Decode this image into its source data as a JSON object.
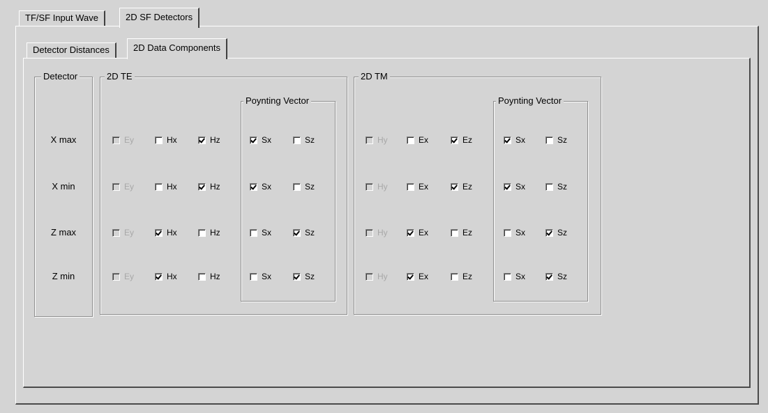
{
  "tabs": [
    "TF/SF Input Wave",
    "2D SF Detectors"
  ],
  "subtabs": [
    "Detector Distances",
    "2D Data Components"
  ],
  "groups": {
    "detector": "Detector",
    "te": "2D TE",
    "tm": "2D TM",
    "poynting": "Poynting Vector"
  },
  "rows": [
    "X max",
    "X min",
    "Z max",
    "Z min"
  ],
  "te_fields": [
    "Ey",
    "Hx",
    "Hz"
  ],
  "te_poynting": [
    "Sx",
    "Sz"
  ],
  "tm_fields": [
    "Hy",
    "Ex",
    "Ez"
  ],
  "tm_poynting": [
    "Sx",
    "Sz"
  ],
  "te_state": [
    {
      "fields": [
        false,
        false,
        true
      ],
      "poynting": [
        true,
        false
      ]
    },
    {
      "fields": [
        false,
        false,
        true
      ],
      "poynting": [
        true,
        false
      ]
    },
    {
      "fields": [
        false,
        true,
        false
      ],
      "poynting": [
        false,
        true
      ]
    },
    {
      "fields": [
        false,
        true,
        false
      ],
      "poynting": [
        false,
        true
      ]
    }
  ],
  "tm_state": [
    {
      "fields": [
        false,
        false,
        true
      ],
      "poynting": [
        true,
        false
      ]
    },
    {
      "fields": [
        false,
        false,
        true
      ],
      "poynting": [
        true,
        false
      ]
    },
    {
      "fields": [
        false,
        true,
        false
      ],
      "poynting": [
        false,
        true
      ]
    },
    {
      "fields": [
        false,
        true,
        false
      ],
      "poynting": [
        false,
        true
      ]
    }
  ],
  "disabled_field": "first"
}
